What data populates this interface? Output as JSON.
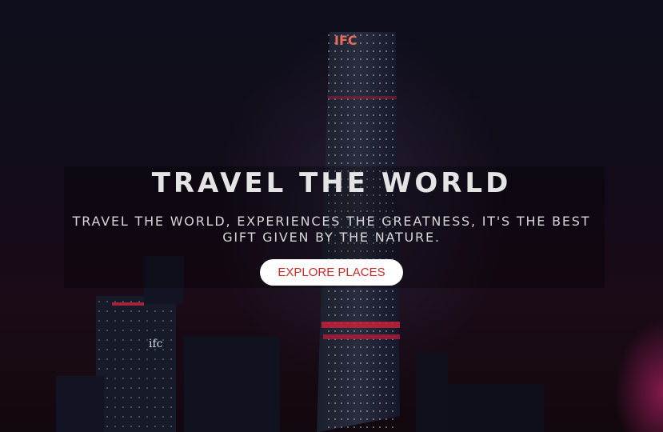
{
  "hero": {
    "title": "TRAVEL THE WORLD",
    "subtitle": "TRAVEL THE WORLD, EXPERIENCES THE GREATNESS, IT'S THE BEST GIFT GIVEN BY THE NATURE.",
    "cta_label": "EXPLORE PLACES",
    "tower_sign": "IFC",
    "building_sign": "ifc"
  },
  "colors": {
    "title": "#e4e4e4",
    "cta_bg": "#ffffff",
    "cta_text": "#cf2a2a",
    "accent_glow": "#dc2878"
  }
}
